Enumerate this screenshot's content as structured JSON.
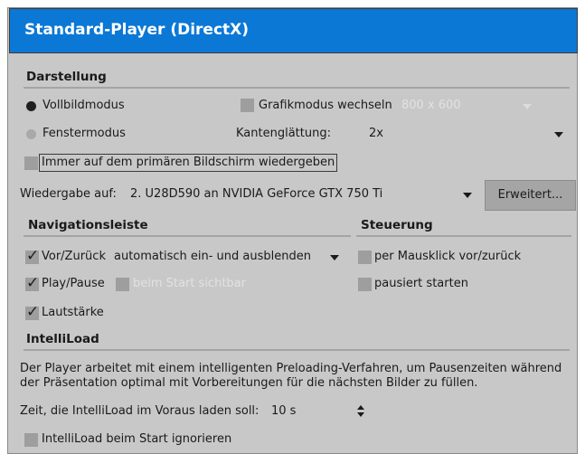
{
  "title": "Standard-Player (DirectX)",
  "darstellung": {
    "heading": "Darstellung",
    "vollbild": "Vollbildmodus",
    "fenster": "Fenstermodus",
    "grafikmodus": "Grafikmodus wechseln",
    "grafik_value": "800 x 600",
    "kanten_label": "Kantenglättung:",
    "kanten_value": "2x",
    "immer": "Immer auf dem primären Bildschirm wiedergeben"
  },
  "wiedergabe": {
    "label": "Wiedergabe auf:",
    "value": "2. U28D590 an NVIDIA GeForce GTX 750 Ti",
    "button": "Erweitert..."
  },
  "navigation": {
    "heading": "Navigationsleiste",
    "vorzurueck": "Vor/Zurück",
    "vorzurueck_value": "automatisch ein- und ausblenden",
    "playpause": "Play/Pause",
    "beimstart": "beim Start sichtbar",
    "lautstaerke": "Lautstärke"
  },
  "steuerung": {
    "heading": "Steuerung",
    "mausklick": "per Mausklick vor/zurück",
    "pausiert": "pausiert starten"
  },
  "intelliload": {
    "heading": "IntelliLoad",
    "desc1": "Der Player arbeitet mit einem intelligenten Preloading-Verfahren, um Pausenzeiten während",
    "desc2": "der Präsentation optimal mit Vorbereitungen für die nächsten Bilder zu füllen.",
    "zeit_label": "Zeit, die IntelliLoad im Voraus laden soll:",
    "zeit_value": "10 s",
    "ignorieren": "IntelliLoad beim Start ignorieren"
  }
}
